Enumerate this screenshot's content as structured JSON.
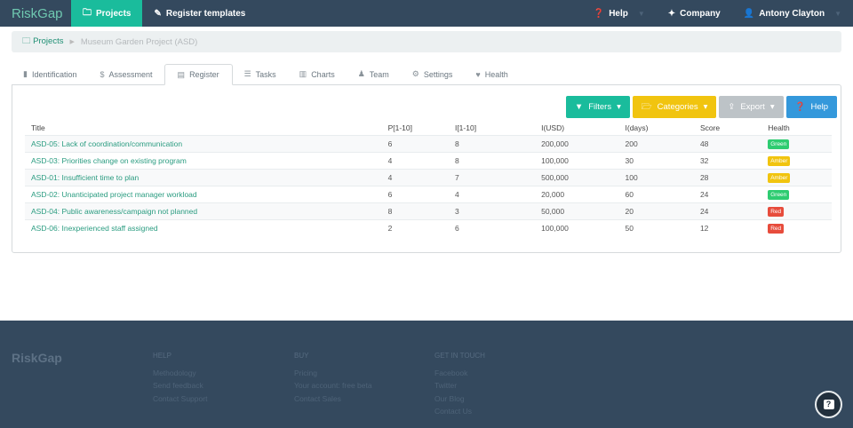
{
  "nav": {
    "brand": "RiskGap",
    "items": [
      {
        "label": "Projects",
        "icon": "folder-icon"
      },
      {
        "label": "Register templates",
        "icon": "edit-icon"
      }
    ],
    "help": "Help",
    "company": "Company",
    "user": "Antony Clayton"
  },
  "breadcrumb": {
    "root": "Projects",
    "current": "Museum Garden Project (ASD)"
  },
  "tabs": [
    {
      "label": "Identification",
      "icon": "file-icon"
    },
    {
      "label": "Assessment",
      "icon": "dollar-icon"
    },
    {
      "label": "Register",
      "icon": "list-icon",
      "active": true
    },
    {
      "label": "Tasks",
      "icon": "tasks-icon"
    },
    {
      "label": "Charts",
      "icon": "bar-chart-icon"
    },
    {
      "label": "Team",
      "icon": "user-icon"
    },
    {
      "label": "Settings",
      "icon": "gear-icon"
    },
    {
      "label": "Health",
      "icon": "heart-icon"
    }
  ],
  "toolbar": {
    "filters": "Filters",
    "categories": "Categories",
    "export": "Export",
    "help": "Help"
  },
  "colors": {
    "green": "#2ecc71",
    "amber": "#f1c40f",
    "red": "#e74c3c",
    "teal": "#1abc9c",
    "navy": "#34495e"
  },
  "table": {
    "headers": [
      "Title",
      "P[1-10]",
      "I[1-10]",
      "I(USD)",
      "I(days)",
      "Score",
      "Health"
    ],
    "rows": [
      [
        "ASD-05: Lack of coordination/communication",
        "6",
        "8",
        "200,000",
        "200",
        "48",
        "Green"
      ],
      [
        "ASD-03: Priorities change on existing program",
        "4",
        "8",
        "100,000",
        "30",
        "32",
        "Amber"
      ],
      [
        "ASD-01: Insufficient time to plan",
        "4",
        "7",
        "500,000",
        "100",
        "28",
        "Amber"
      ],
      [
        "ASD-02: Unanticipated project manager workload",
        "6",
        "4",
        "20,000",
        "60",
        "24",
        "Green"
      ],
      [
        "ASD-04: Public awareness/campaign not planned",
        "8",
        "3",
        "50,000",
        "20",
        "24",
        "Red"
      ],
      [
        "ASD-06: Inexperienced staff assigned",
        "2",
        "6",
        "100,000",
        "50",
        "12",
        "Red"
      ]
    ]
  },
  "footer": {
    "brand": "RiskGap",
    "columns": [
      {
        "heading": "HELP",
        "links": [
          "Methodology",
          "Send feedback",
          "Contact Support"
        ]
      },
      {
        "heading": "BUY",
        "links": [
          "Pricing",
          "Your account: free beta",
          "Contact Sales"
        ]
      },
      {
        "heading": "GET IN TOUCH",
        "links": [
          "Facebook",
          "Twitter",
          "Our Blog",
          "Contact Us"
        ]
      }
    ]
  },
  "chat": {
    "label": "?"
  }
}
